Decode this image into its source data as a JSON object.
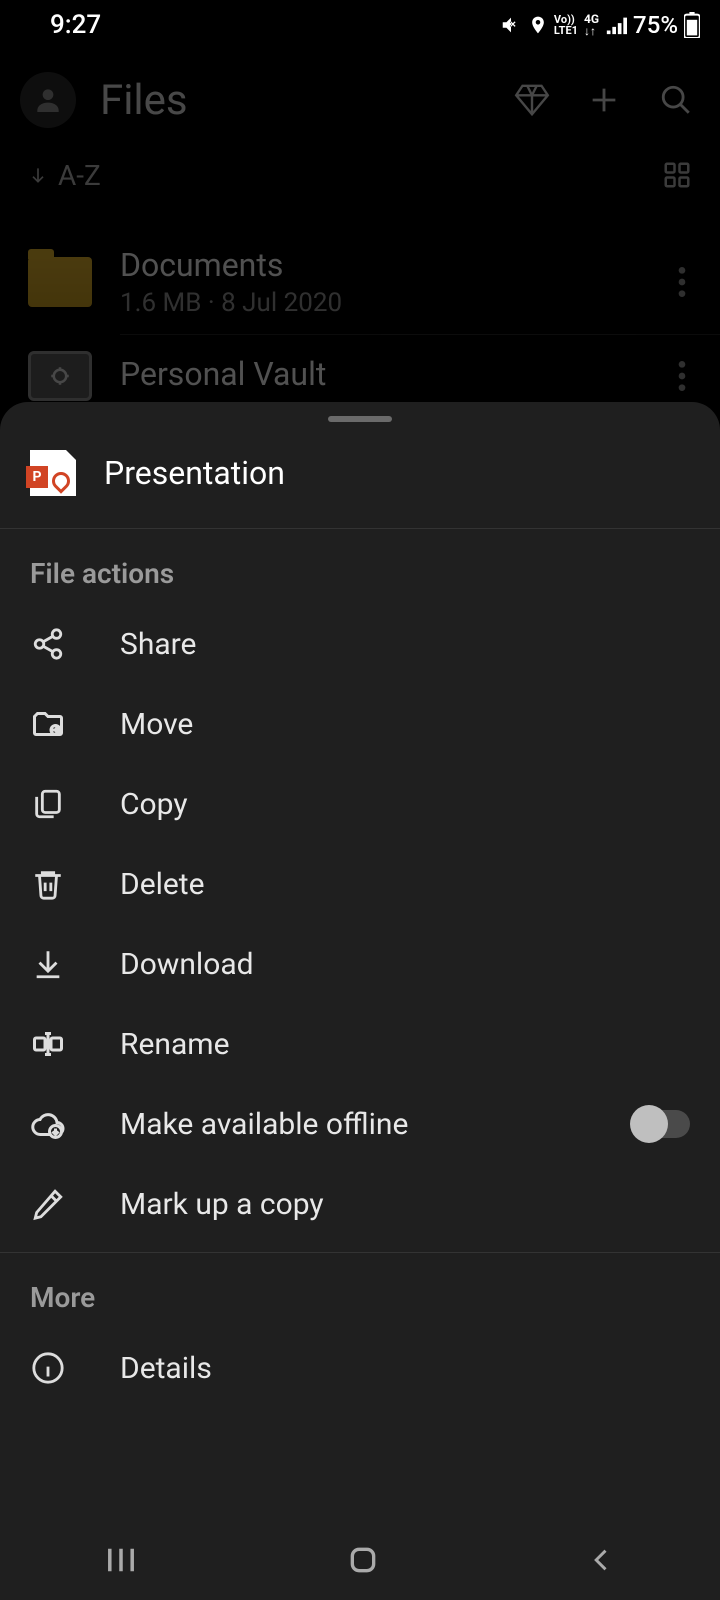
{
  "status": {
    "time": "9:27",
    "battery": "75%"
  },
  "header": {
    "title": "Files"
  },
  "sort": {
    "label": "A-Z"
  },
  "files": [
    {
      "name": "Documents",
      "meta": "1.6 MB · 8 Jul 2020"
    },
    {
      "name": "Personal Vault",
      "meta": ""
    }
  ],
  "sheet": {
    "title": "Presentation",
    "sections": {
      "actions_label": "File actions",
      "more_label": "More"
    },
    "actions": {
      "share": "Share",
      "move": "Move",
      "copy": "Copy",
      "delete": "Delete",
      "download": "Download",
      "rename": "Rename",
      "offline": "Make available offline",
      "markup": "Mark up a copy",
      "details": "Details"
    },
    "offline_on": false
  }
}
